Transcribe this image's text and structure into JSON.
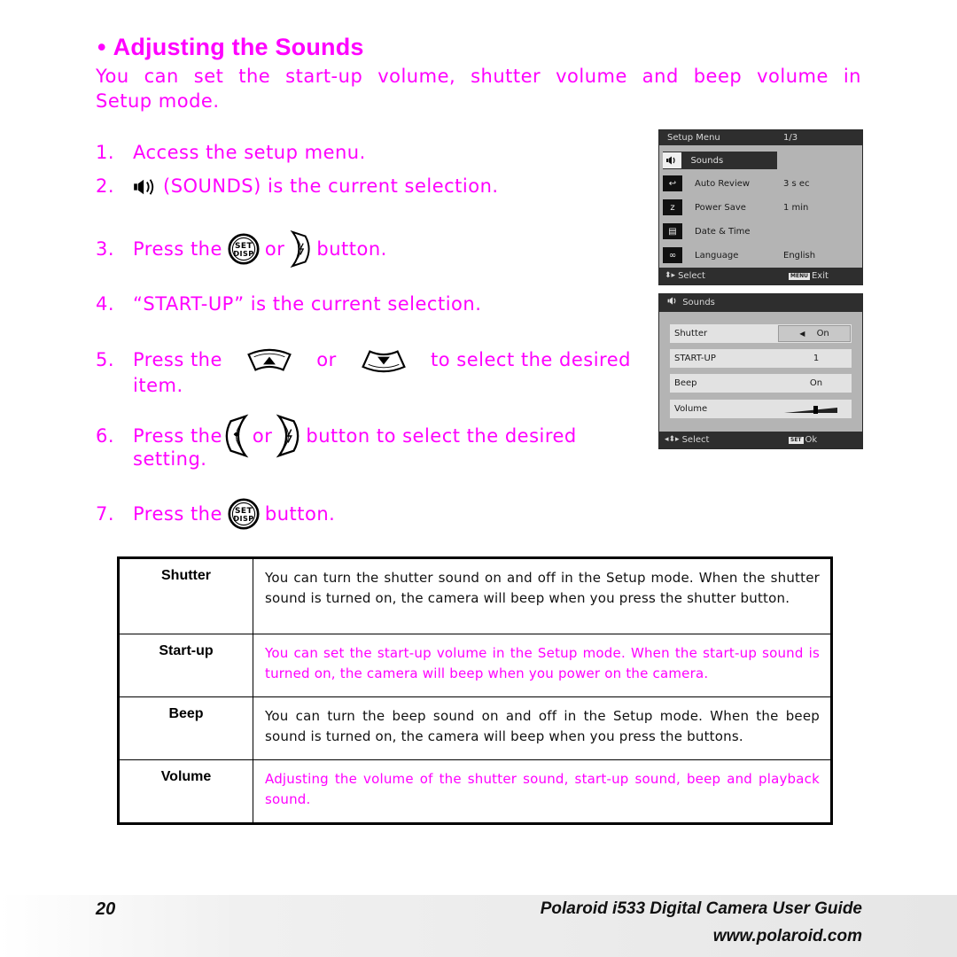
{
  "heading": {
    "bullet": "•",
    "title": "Adjusting the Sounds"
  },
  "intro": {
    "line1": "You can set the start-up volume, shutter volume and beep volume in",
    "line2": "Setup mode."
  },
  "steps": [
    {
      "num": "1.",
      "text": "Access the setup menu."
    },
    {
      "num": "2.",
      "icon": "speaker-icon",
      "text": "(SOUNDS) is the current selection."
    },
    {
      "num": "3.",
      "pre": "Press the",
      "icon1": "set-disp-button-icon",
      "mid": "or",
      "icon2": "right-flash-button-icon",
      "post": "button."
    },
    {
      "num": "4.",
      "text": "“START-UP” is the current selection."
    },
    {
      "num": "5.",
      "pre": "Press the",
      "icon1": "up-button-icon",
      "mid": "or",
      "icon2": "down-button-icon",
      "post": "to select the desired",
      "line2": "item."
    },
    {
      "num": "6.",
      "pre": "Press the",
      "icon1": "left-macro-button-icon",
      "mid": "or",
      "icon2": "right-flash-button-icon",
      "post": "button to select the desired",
      "line2": "setting."
    },
    {
      "num": "7.",
      "pre": "Press the",
      "icon1": "set-disp-button-icon",
      "post": "button."
    }
  ],
  "icon_labels": {
    "set_top": "SET",
    "set_bottom": "DISP"
  },
  "lcd_setup": {
    "title": "Setup Menu",
    "page": "1/3",
    "items": [
      {
        "icon": "speaker-icon",
        "label": "Sounds",
        "value": "",
        "selected": true
      },
      {
        "icon": "auto-review-icon",
        "label": "Auto Review",
        "value": "3 s ec"
      },
      {
        "icon": "power-save-icon",
        "label": "Power Save",
        "value": "1 min"
      },
      {
        "icon": "date-time-icon",
        "label": "Date & Time",
        "value": ""
      },
      {
        "icon": "language-icon",
        "label": "Language",
        "value": "English"
      }
    ],
    "footer_select": "Select",
    "footer_chip": "MENU",
    "footer_exit": "Exit"
  },
  "lcd_sounds": {
    "title": "Sounds",
    "rows": [
      {
        "label": "Shutter",
        "value": "On",
        "active": true,
        "arrow": "◀"
      },
      {
        "label": "START-UP",
        "value": "1"
      },
      {
        "label": "Beep",
        "value": "On"
      },
      {
        "label": "Volume",
        "value": "",
        "volume_level": 0.6
      }
    ],
    "footer_select": "Select",
    "footer_chip": "SET",
    "footer_ok": "Ok"
  },
  "table": {
    "rows": [
      {
        "key": "Shutter",
        "desc": "You can turn the shutter sound on and off in the Setup mode. When the shutter sound is turned on, the camera will beep when you press the shutter button.",
        "color": "black"
      },
      {
        "key": "Start-up",
        "desc": "You can set the start-up volume in the Setup mode. When the start-up sound is turned on, the camera will beep when you power on the camera.",
        "color": "pink"
      },
      {
        "key": "Beep",
        "desc": "You can turn the beep sound on and off in the Setup mode. When the beep sound is turned on, the camera will beep when you press the buttons.",
        "color": "black"
      },
      {
        "key": "Volume",
        "desc": "Adjusting the volume of the shutter sound, start-up sound, beep and playback sound.",
        "color": "pink"
      }
    ]
  },
  "footer": {
    "page_number": "20",
    "title": "Polaroid i533 Digital Camera User Guide",
    "url": "www.polaroid.com"
  },
  "colors": {
    "accent": "#ff00ff",
    "lcd_bg": "#b4b4b4",
    "lcd_bar": "#2e2e2e"
  }
}
